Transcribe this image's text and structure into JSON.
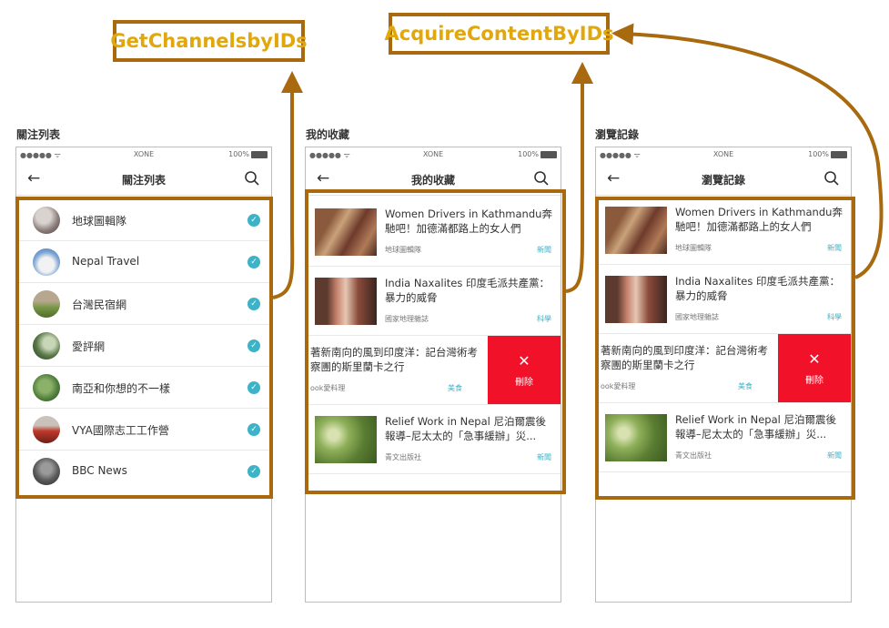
{
  "callouts": {
    "channels": "GetChannelsbyIDs",
    "content": "AcquireContentByIDs"
  },
  "status": {
    "signal": "●●●●● ᯤ",
    "carrier": "XONE",
    "battery": "100%"
  },
  "icons": {
    "back": "arrow-left-icon",
    "search": "search-icon",
    "check": "check-icon",
    "close": "close-icon"
  },
  "colors": {
    "highlight": "#a9690e",
    "callout_text": "#e1a70b",
    "accent": "#3eb3c7",
    "delete": "#f1122a"
  },
  "screens": {
    "subscriptions": {
      "caption": "關注列表",
      "title": "關注列表",
      "items": [
        {
          "name": "地球圖輯隊"
        },
        {
          "name": "Nepal Travel"
        },
        {
          "name": "台灣民宿網"
        },
        {
          "name": "愛評網"
        },
        {
          "name": "南亞和你想的不一樣"
        },
        {
          "name": "VYA國際志工工作營"
        },
        {
          "name": "BBC News"
        }
      ]
    },
    "favorites": {
      "caption": "我的收藏",
      "title": "我的收藏",
      "articles": [
        {
          "title": "Women Drivers in Kathmandu奔馳吧！加德滿都路上的女人們",
          "source": "地球圖輯隊",
          "tag": "新聞"
        },
        {
          "title": "India Naxalites 印度毛派共產黨：暴力的威脅",
          "source": "國家地理雜誌",
          "tag": "科學"
        },
        {
          "title": "著新南向的風到印度洋：記台灣術考察團的斯里蘭卡之行",
          "source": "ook愛料理",
          "tag": "美食",
          "delete_label": "刪除"
        },
        {
          "title": "Relief Work in Nepal 尼泊爾震後報導–尼太太的「急事緩辦」災...",
          "source": "青文出版社",
          "tag": "新聞"
        }
      ]
    },
    "history": {
      "caption": "瀏覽記錄",
      "title": "瀏覽記錄",
      "articles": [
        {
          "title": "Women Drivers in Kathmandu奔馳吧！加德滿都路上的女人們",
          "source": "地球圖輯隊",
          "tag": "新聞"
        },
        {
          "title": "India Naxalites 印度毛派共產黨：暴力的威脅",
          "source": "國家地理雜誌",
          "tag": "科學"
        },
        {
          "title": "著新南向的風到印度洋：記台灣術考察團的斯里蘭卡之行",
          "source": "ook愛料理",
          "tag": "美食",
          "delete_label": "刪除"
        },
        {
          "title": "Relief Work in Nepal 尼泊爾震後報導–尼太太的「急事緩辦」災...",
          "source": "青文出版社",
          "tag": "新聞"
        }
      ]
    }
  }
}
